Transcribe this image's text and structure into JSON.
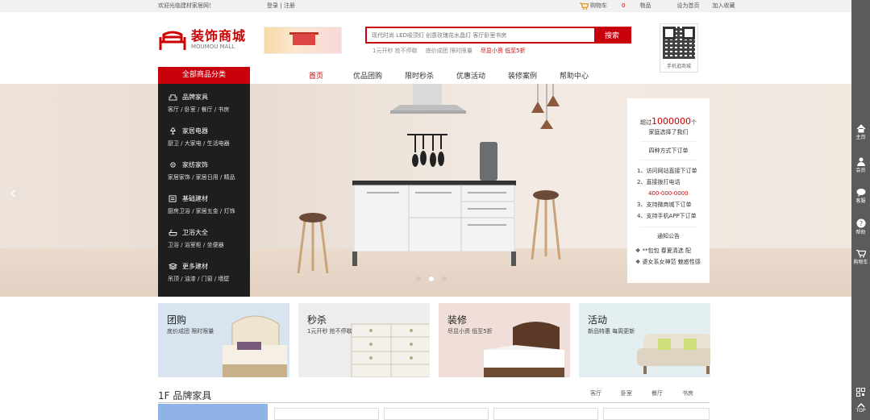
{
  "topbar": {
    "welcome": "欢迎光临建材家居网！",
    "login": "登录",
    "sep": "|",
    "register": "注册",
    "cart_prefix": "购物车",
    "cart_count": "0",
    "cart_suffix": "物品",
    "set_home": "设为首页",
    "bookmark": "加入收藏"
  },
  "logo": {
    "cn": "装饰商城",
    "en": "MOUMOU MALL"
  },
  "search": {
    "placeholder": "现代时尚 LED吸顶灯 创意玫瑰花水晶灯 客厅卧室书房",
    "button": "搜索",
    "hot": [
      "1元开秒 抢不停歇",
      "底价成团 限时限量",
      "尽显小资 低至5折"
    ]
  },
  "qr": {
    "label": "手机逛商城"
  },
  "nav": {
    "all_categories": "全部商品分类",
    "links": [
      "首页",
      "优品团购",
      "限时秒杀",
      "优惠活动",
      "装修案例",
      "帮助中心"
    ]
  },
  "categories": [
    {
      "title": "品牌家具",
      "sub": "客厅 / 卧室 / 餐厅 / 书房",
      "icon": "sofa-icon"
    },
    {
      "title": "家居电器",
      "sub": "厨卫 / 大家电 / 生活电器",
      "icon": "lamp-icon"
    },
    {
      "title": "家纺家饰",
      "sub": "家居家饰 / 家居日用 / 精品",
      "icon": "gear-icon"
    },
    {
      "title": "基础建材",
      "sub": "厨房卫浴 / 家居五金 / 灯饰",
      "icon": "list-icon"
    },
    {
      "title": "卫浴大全",
      "sub": "卫浴 / 浴室柜 / 坐便器",
      "icon": "bathtub-icon"
    },
    {
      "title": "更多建材",
      "sub": "吊顶 / 油漆 / 门窗 / 墙壁",
      "icon": "layers-icon"
    }
  ],
  "order_box": {
    "line1_prefix": "超过",
    "line1_number": "1000000",
    "line1_suffix": "个",
    "line2": "家庭选择了我们",
    "ways_title": "四种方式下订单",
    "steps": [
      "1、访问网站直接下订单",
      "2、直接拨打电话",
      "3、支持微商城下订单",
      "4、支持手机APP下订单"
    ],
    "phone": "400-000-0000",
    "notice_title": "通知公告",
    "notices": [
      "**包包 春夏清选 配",
      "婆女系女神范 魅惑性感"
    ]
  },
  "promos": [
    {
      "title": "团购",
      "sub": "底价成团 限时限量"
    },
    {
      "title": "秒杀",
      "sub": "1元开秒 抢不停歇"
    },
    {
      "title": "装修",
      "sub": "尽显小资 低至5折"
    },
    {
      "title": "活动",
      "sub": "新品特惠 每周更新"
    }
  ],
  "floor": {
    "title": "1F 品牌家具",
    "tabs": [
      "客厅",
      "卧室",
      "餐厅",
      "书房"
    ]
  },
  "rail": {
    "items": [
      "主页",
      "会员",
      "客服",
      "帮助",
      "购物车"
    ],
    "top": "TOP"
  },
  "colors": {
    "brand_red": "#c8000b",
    "sidebar_dark": "#1e1e1e",
    "rail_gray": "#5b5b5b"
  }
}
